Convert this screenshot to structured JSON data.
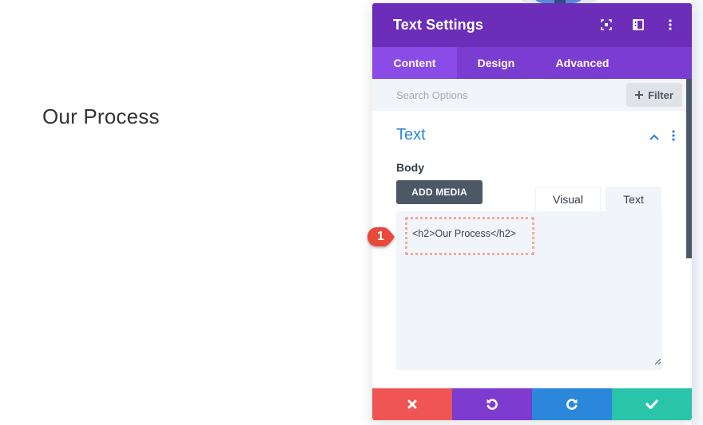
{
  "page": {
    "heading": "Our Process"
  },
  "modal": {
    "title": "Text Settings",
    "header_icons": [
      "focus-mode-icon",
      "split-view-icon",
      "more-options-icon"
    ],
    "tabs": [
      {
        "label": "Content",
        "active": true
      },
      {
        "label": "Design",
        "active": false
      },
      {
        "label": "Advanced",
        "active": false
      }
    ],
    "search": {
      "placeholder": "Search Options",
      "value": ""
    },
    "filter_label": "Filter",
    "section": {
      "title": "Text",
      "expanded": true
    },
    "body_field": {
      "label": "Body",
      "add_media_label": "ADD MEDIA",
      "editor_tabs": [
        {
          "label": "Visual",
          "active": false
        },
        {
          "label": "Text",
          "active": true
        }
      ],
      "content": "<h2>Our Process</h2>"
    },
    "callout_number": "1",
    "footer_buttons": [
      {
        "name": "discard",
        "icon": "close-icon"
      },
      {
        "name": "undo",
        "icon": "undo-icon"
      },
      {
        "name": "redo",
        "icon": "redo-icon"
      },
      {
        "name": "save",
        "icon": "check-icon"
      }
    ]
  },
  "colors": {
    "header": "#6c2eb9",
    "tabs_bar": "#7b3dd1",
    "active_tab": "#8b4be6",
    "section_title": "#2b87da",
    "discard": "#ef5555",
    "undo": "#7e3bd0",
    "redo": "#2b87da",
    "save": "#29c4a9",
    "highlight": "#f2a9a0",
    "callout": "#e8483b"
  }
}
